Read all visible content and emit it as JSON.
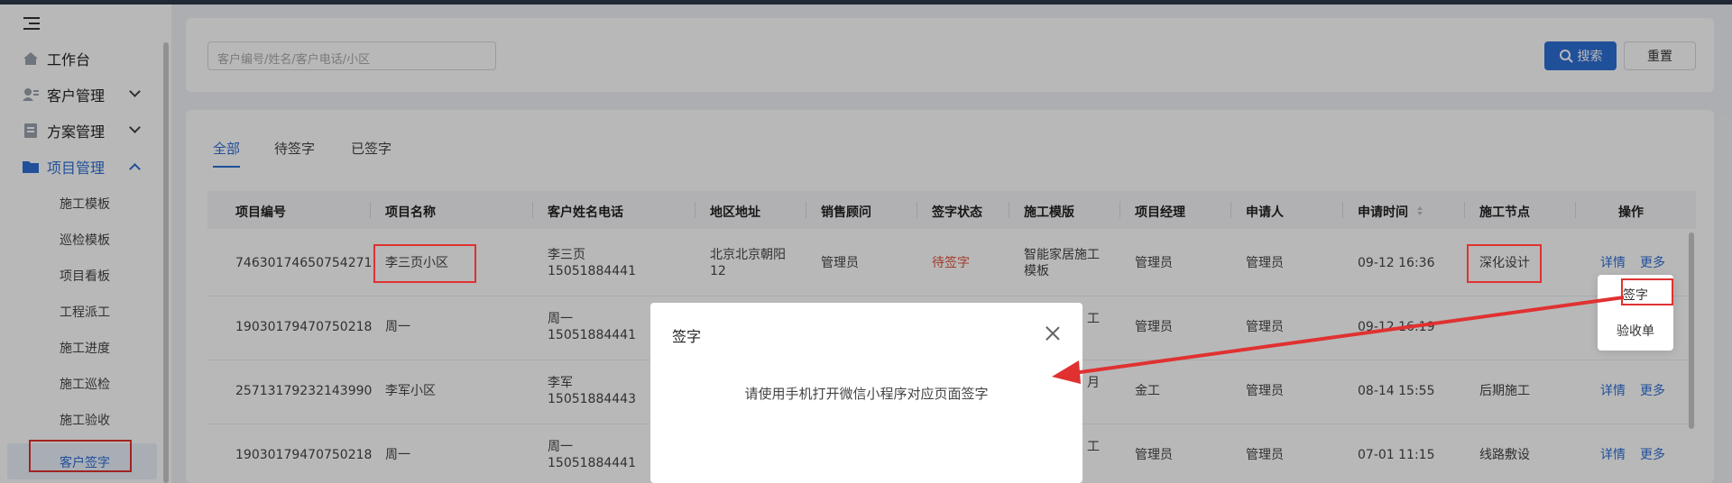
{
  "sidebar": {
    "items": [
      {
        "label": "工作台",
        "icon": "home-icon"
      },
      {
        "label": "客户管理",
        "icon": "customer-icon"
      },
      {
        "label": "方案管理",
        "icon": "document-icon"
      },
      {
        "label": "项目管理",
        "icon": "folder-icon"
      }
    ],
    "sub_items": [
      "施工模板",
      "巡检模板",
      "项目看板",
      "工程派工",
      "施工进度",
      "施工巡检",
      "施工验收"
    ],
    "active_sub": "客户签字"
  },
  "search": {
    "placeholder": "客户编号/姓名/客户电话/小区",
    "search_label": "搜索",
    "reset_label": "重置"
  },
  "tabs": [
    "全部",
    "待签字",
    "已签字"
  ],
  "table": {
    "headers": [
      "项目编号",
      "项目名称",
      "客户姓名电话",
      "地区地址",
      "销售顾问",
      "签字状态",
      "施工模版",
      "项目经理",
      "申请人",
      "申请时间",
      "施工节点",
      "操作"
    ],
    "rows": [
      {
        "code": "74630174650754271",
        "name": "李三页小区",
        "customer": "李三页",
        "phone": "15051884441",
        "addr1": "北京北京朝阳",
        "addr2": "12",
        "sales": "管理员",
        "status": "待签字",
        "tpl1": "智能家居施工",
        "tpl2": "模板",
        "manager": "管理员",
        "applicant": "管理员",
        "time": "09-12 16:36",
        "node": "深化设计",
        "detail": "详情",
        "more": "更多"
      },
      {
        "code": "19030179470750218",
        "name": "周一",
        "customer": "周一",
        "phone": "15051884441",
        "tpl_partial": "工",
        "manager": "管理员",
        "applicant": "管理员",
        "time": "09-12 16:19"
      },
      {
        "code": "25713179232143990",
        "name": "李军小区",
        "customer": "李军",
        "phone": "15051884443",
        "tpl_partial": "月",
        "manager": "金工",
        "applicant": "管理员",
        "time": "08-14 15:55",
        "node": "后期施工",
        "detail": "详情",
        "more": "更多"
      },
      {
        "code": "19030179470750218",
        "name": "周一",
        "customer": "周一",
        "phone": "15051884441",
        "tpl_partial": "工",
        "manager": "管理员",
        "applicant": "管理员",
        "time": "07-01 11:15",
        "node": "线路敷设",
        "detail": "详情",
        "more": "更多"
      }
    ]
  },
  "dropdown": {
    "items": [
      "签字",
      "验收单"
    ]
  },
  "modal": {
    "title": "签字",
    "body": "请使用手机打开微信小程序对应页面签字"
  },
  "colors": {
    "accent": "#2f6fd6",
    "pending": "#e0523c",
    "annotation": "#e03131"
  }
}
